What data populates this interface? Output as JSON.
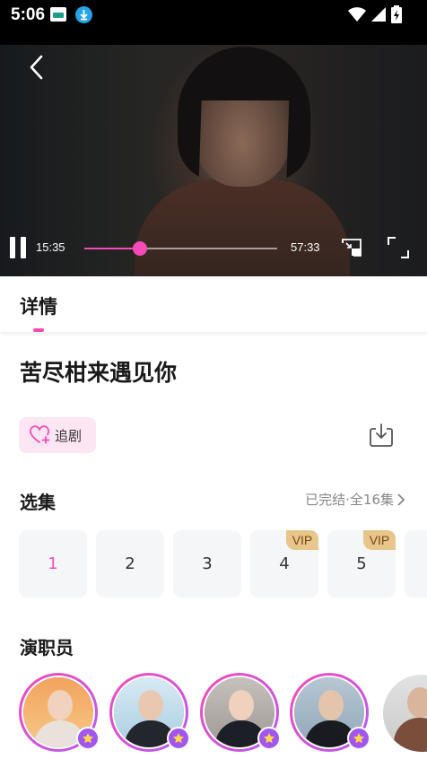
{
  "status_bar": {
    "time": "5:06"
  },
  "player": {
    "current_time": "15:35",
    "total_time": "57:33",
    "progress": 0.29
  },
  "tabs": [
    {
      "label": "详情"
    }
  ],
  "show": {
    "title": "苦尽柑来遇见你"
  },
  "follow": {
    "label": "追剧"
  },
  "episodes": {
    "heading": "选集",
    "status": "已完结·全16集",
    "items": [
      {
        "label": "1",
        "vip": false,
        "active": true
      },
      {
        "label": "2",
        "vip": false,
        "active": false
      },
      {
        "label": "3",
        "vip": false,
        "active": false
      },
      {
        "label": "4",
        "vip": true,
        "active": false
      },
      {
        "label": "5",
        "vip": true,
        "active": false
      }
    ],
    "vip_label": "VIP"
  },
  "cast": {
    "heading": "演职员"
  },
  "colors": {
    "accent": "#f64bb7",
    "vip_gold": "#e8c58a",
    "follow_bg": "#fde6f4"
  },
  "icons": [
    "back-icon",
    "pause-icon",
    "pip-icon",
    "fullscreen-icon",
    "heart-plus-icon",
    "download-icon",
    "chevron-right-icon",
    "star-icon"
  ]
}
